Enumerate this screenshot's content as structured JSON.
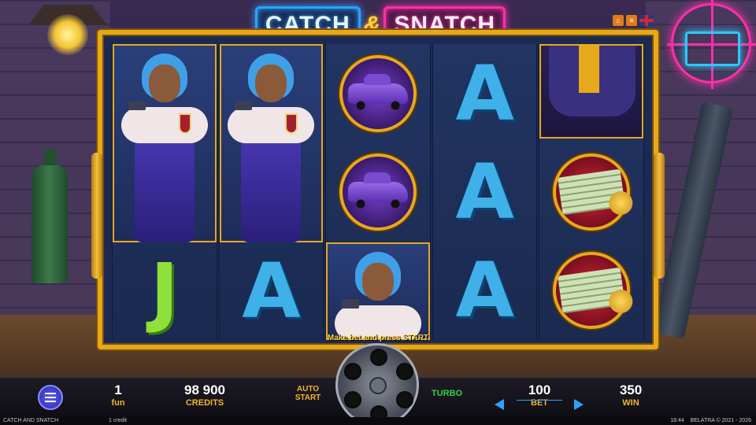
{
  "logo": {
    "part1": "CATCH",
    "amp": "&",
    "part2": "SNATCH"
  },
  "top_icons": [
    "home-icon",
    "history-icon",
    "language-flag-icon"
  ],
  "reels": [
    [
      "lady-tall",
      "J"
    ],
    [
      "lady-tall",
      "A"
    ],
    [
      "car",
      "car",
      "lady"
    ],
    [
      "A",
      "A",
      "A"
    ],
    [
      "boss",
      "money",
      "money"
    ]
  ],
  "status_message": "Make bet and press START",
  "bottom_bar": {
    "fun": {
      "value": "1",
      "label": "fun"
    },
    "credits": {
      "value": "98 900",
      "label": "CREDITS"
    },
    "autostart": "AUTO START",
    "turbo": "TURBO",
    "bet": {
      "value": "100",
      "label": "BET"
    },
    "win": {
      "value": "350",
      "label": "WIN"
    }
  },
  "footer": {
    "game_title": "CATCH AND SNATCH",
    "credit_value": "1 credit",
    "time": "18:44",
    "copyright": "BELATRA © 2021 - 2026"
  },
  "colors": {
    "frame_gold": "#e7a91c",
    "label_gold": "#f2b620",
    "turbo_green": "#2fd24a",
    "neon_blue": "#2aa2ff",
    "neon_pink": "#ff2fa6"
  }
}
